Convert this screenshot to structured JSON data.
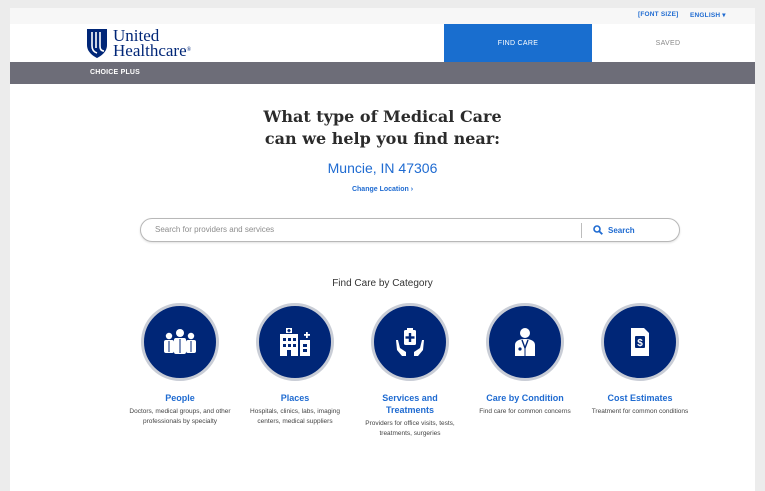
{
  "topbar": {
    "font_size_label": "[FONT SIZE]",
    "language_label": "ENGLISH ▾"
  },
  "header": {
    "logo_line1": "United",
    "logo_line2": "Healthcare",
    "logo_mark": "®",
    "nav_find_care": "FIND CARE",
    "nav_saved": "SAVED"
  },
  "plan": {
    "name": "CHOICE PLUS"
  },
  "main": {
    "heading_line1": "What type of Medical Care",
    "heading_line2": "can we help you find near:",
    "location": "Muncie, IN 47306",
    "change_location": "Change Location ›",
    "search_placeholder": "Search for providers and services",
    "search_button": "Search",
    "category_title": "Find Care by Category"
  },
  "categories": [
    {
      "icon": "people-icon",
      "label": "People",
      "desc": "Doctors, medical groups, and other professionals by specialty"
    },
    {
      "icon": "buildings-icon",
      "label": "Places",
      "desc": "Hospitals, clinics, labs, imaging centers, medical suppliers"
    },
    {
      "icon": "medical-kit-hands-icon",
      "label": "Services and Treatments",
      "desc": "Providers for office visits, tests, treatments, surgeries"
    },
    {
      "icon": "doctor-icon",
      "label": "Care by Condition",
      "desc": "Find care for common concerns"
    },
    {
      "icon": "cost-document-icon",
      "label": "Cost Estimates",
      "desc": "Treatment for common conditions"
    }
  ],
  "colors": {
    "brand_navy": "#002677",
    "accent_blue": "#196ecf",
    "link_blue": "#1f6bd1",
    "plan_bar": "#6d6d78"
  }
}
